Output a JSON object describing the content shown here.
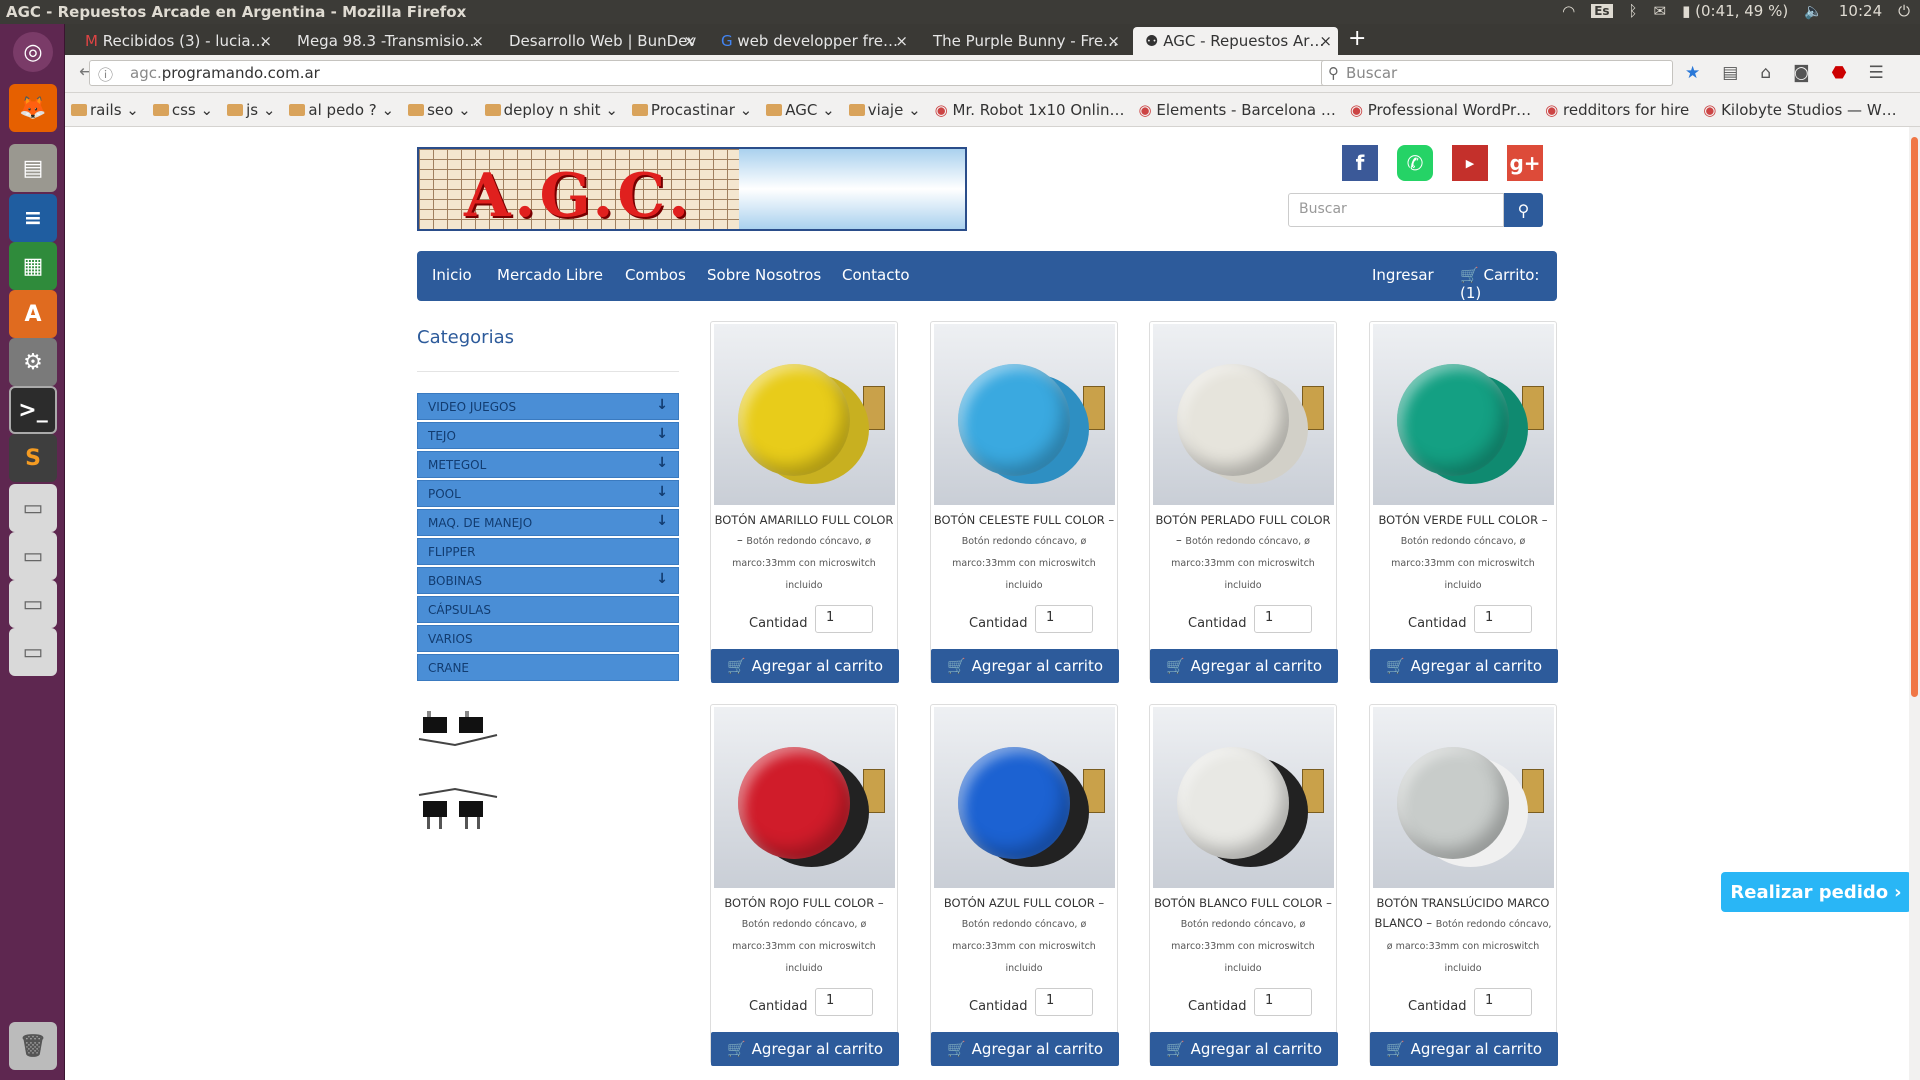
{
  "window": {
    "title": "AGC - Repuestos Arcade en Argentina - Mozilla Firefox",
    "tray": {
      "keyboard": "Es",
      "battery": "(0:41, 49 %)",
      "clock": "10:24"
    }
  },
  "tabs": [
    {
      "label": "Recibidos (3) - lucia…",
      "x": "×"
    },
    {
      "label": "Mega 98.3 -Transmisio…",
      "x": "×"
    },
    {
      "label": "Desarrollo Web | BunDev",
      "x": "×"
    },
    {
      "label": "web developper fre…",
      "x": "×"
    },
    {
      "label": "The Purple Bunny - Fre…",
      "x": "×"
    },
    {
      "label": "AGC - Repuestos Ar…",
      "x": "×"
    }
  ],
  "newtab": "+",
  "url": {
    "domain": "agc.",
    "host": "programando.com.ar"
  },
  "browser_search": {
    "placeholder": "Buscar"
  },
  "bookmarks": [
    {
      "label": "rails",
      "folder": true
    },
    {
      "label": "css",
      "folder": true
    },
    {
      "label": "js",
      "folder": true
    },
    {
      "label": "al pedo ?",
      "folder": true
    },
    {
      "label": "seo",
      "folder": true
    },
    {
      "label": "deploy n shit",
      "folder": true
    },
    {
      "label": "Procastinar",
      "folder": true
    },
    {
      "label": "AGC",
      "folder": true
    },
    {
      "label": "viaje",
      "folder": true
    },
    {
      "label": "Mr. Robot 1x10 Onlin…",
      "folder": false
    },
    {
      "label": "Elements - Barcelona …",
      "folder": false
    },
    {
      "label": "Professional WordPr…",
      "folder": false
    },
    {
      "label": "redditors for hire",
      "folder": false
    },
    {
      "label": "Kilobyte Studios — W…",
      "folder": false
    }
  ],
  "site": {
    "logo_text": "A.G.C.",
    "search_placeholder": "Buscar",
    "menu": [
      "Inicio",
      "Mercado Libre",
      "Combos",
      "Sobre Nosotros",
      "Contacto"
    ],
    "login": "Ingresar",
    "cart": "Carrito: (1)",
    "categories_title": "Categorias",
    "categories": [
      {
        "label": "VIDEO JUEGOS",
        "expandable": true
      },
      {
        "label": "TEJO",
        "expandable": true
      },
      {
        "label": "METEGOL",
        "expandable": true
      },
      {
        "label": "POOL",
        "expandable": true
      },
      {
        "label": "MAQ. DE MANEJO",
        "expandable": true
      },
      {
        "label": "FLIPPER",
        "expandable": false
      },
      {
        "label": "BOBINAS",
        "expandable": true
      },
      {
        "label": "CÁPSULAS",
        "expandable": false
      },
      {
        "label": "VARIOS",
        "expandable": false
      },
      {
        "label": "CRANE",
        "expandable": false
      }
    ],
    "qty_label": "Cantidad",
    "add_label": "Agregar al carrito",
    "order_button": "Realizar pedido",
    "products": [
      {
        "name": "BOTÓN AMARILLO FULL COLOR –",
        "desc": "Botón redondo cóncavo, ø marco:33mm con microswitch incluido",
        "qty": "1",
        "color": "#e8cc1a",
        "ring": "#c8b020"
      },
      {
        "name": "BOTÓN CELESTE FULL COLOR –",
        "desc": "Botón redondo cóncavo, ø marco:33mm con microswitch incluido",
        "qty": "1",
        "color": "#3aa9e0",
        "ring": "#2e8fc2"
      },
      {
        "name": "BOTÓN PERLADO FULL COLOR –",
        "desc": "Botón redondo cóncavo, ø marco:33mm con microswitch incluido",
        "qty": "1",
        "color": "#e6e4dc",
        "ring": "#d2d0c8"
      },
      {
        "name": "BOTÓN VERDE FULL COLOR –",
        "desc": "Botón redondo cóncavo, ø marco:33mm con microswitch incluido",
        "qty": "1",
        "color": "#14a083",
        "ring": "#0f8a70"
      },
      {
        "name": "BOTÓN ROJO FULL COLOR –",
        "desc": "Botón redondo cóncavo, ø marco:33mm con microswitch incluido",
        "qty": "1",
        "color": "#d01c2a",
        "ring": "#222"
      },
      {
        "name": "BOTÓN AZUL FULL COLOR –",
        "desc": "Botón redondo cóncavo, ø marco:33mm con microswitch incluido",
        "qty": "1",
        "color": "#1c62d2",
        "ring": "#222"
      },
      {
        "name": "BOTÓN BLANCO FULL COLOR –",
        "desc": "Botón redondo cóncavo, ø marco:33mm con microswitch incluido",
        "qty": "1",
        "color": "#e8e8e4",
        "ring": "#222"
      },
      {
        "name": "BOTÓN TRANSLÚCIDO MARCO BLANCO –",
        "desc": "Botón redondo cóncavo, ø marco:33mm con microswitch incluido",
        "qty": "1",
        "color": "#c8ccca",
        "ring": "#f0f0f0"
      }
    ]
  },
  "colors": {
    "brand": "#2d5b9b",
    "category": "#4a8ed6",
    "order_button": "#29b6f6",
    "launcher": "#5e2750"
  }
}
